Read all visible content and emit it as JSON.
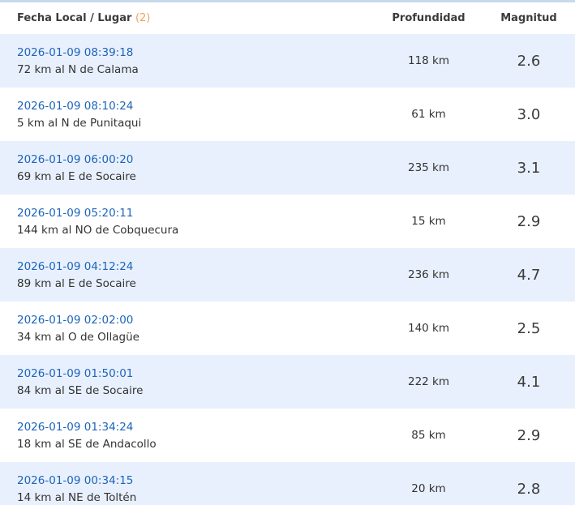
{
  "header": {
    "place_label": "Fecha Local / Lugar",
    "count": "(2)",
    "depth_label": "Profundidad",
    "magnitude_label": "Magnitud"
  },
  "rows": [
    {
      "date": "2026-01-09 08:39:18",
      "place": "72 km al N de Calama",
      "depth": "118 km",
      "magnitude": "2.6"
    },
    {
      "date": "2026-01-09 08:10:24",
      "place": "5 km al N de Punitaqui",
      "depth": "61 km",
      "magnitude": "3.0"
    },
    {
      "date": "2026-01-09 06:00:20",
      "place": "69 km al E de Socaire",
      "depth": "235 km",
      "magnitude": "3.1"
    },
    {
      "date": "2026-01-09 05:20:11",
      "place": "144 km al NO de Cobquecura",
      "depth": "15 km",
      "magnitude": "2.9"
    },
    {
      "date": "2026-01-09 04:12:24",
      "place": "89 km al E de Socaire",
      "depth": "236 km",
      "magnitude": "4.7"
    },
    {
      "date": "2026-01-09 02:02:00",
      "place": "34 km al O de Ollagüe",
      "depth": "140 km",
      "magnitude": "2.5"
    },
    {
      "date": "2026-01-09 01:50:01",
      "place": "84 km al SE de Socaire",
      "depth": "222 km",
      "magnitude": "4.1"
    },
    {
      "date": "2026-01-09 01:34:24",
      "place": "18 km al SE de Andacollo",
      "depth": "85 km",
      "magnitude": "2.9"
    },
    {
      "date": "2026-01-09 00:34:15",
      "place": "14 km al NE de Toltén",
      "depth": "20 km",
      "magnitude": "2.8"
    }
  ],
  "colors": {
    "link": "#1d64b9",
    "row_shade": "#e8f0fd",
    "count": "#f0a15a"
  }
}
